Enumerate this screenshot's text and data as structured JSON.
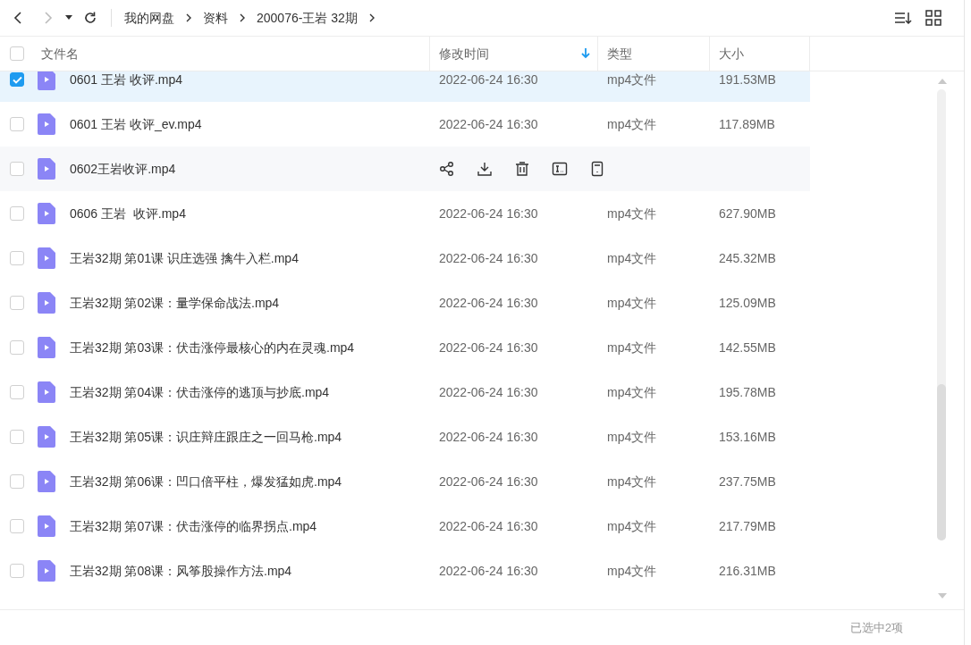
{
  "breadcrumb": [
    "我的网盘",
    "资料",
    "200076-王岩 32期"
  ],
  "columns": [
    {
      "label": "文件名",
      "sorted": false
    },
    {
      "label": "修改时间",
      "sorted": true
    },
    {
      "label": "类型",
      "sorted": false
    },
    {
      "label": "大小",
      "sorted": false
    }
  ],
  "header_checked": false,
  "rows": [
    {
      "name": "0601 王岩 收评.mp4",
      "modified": "2022-06-24 16:30",
      "type": "mp4文件",
      "size": "191.53MB",
      "checked": true,
      "hovered": false
    },
    {
      "name": "0601 王岩 收评_ev.mp4",
      "modified": "2022-06-24 16:30",
      "type": "mp4文件",
      "size": "117.89MB",
      "checked": false,
      "hovered": false
    },
    {
      "name": "0602王岩收评.mp4",
      "checked": false,
      "hovered": true
    },
    {
      "name": "0606 王岩  收评.mp4",
      "modified": "2022-06-24 16:30",
      "type": "mp4文件",
      "size": "627.90MB",
      "checked": false,
      "hovered": false
    },
    {
      "name": "王岩32期 第01课 识庄选强 擒牛入栏.mp4",
      "modified": "2022-06-24 16:30",
      "type": "mp4文件",
      "size": "245.32MB",
      "checked": false,
      "hovered": false
    },
    {
      "name": "王岩32期 第02课：量学保命战法.mp4",
      "modified": "2022-06-24 16:30",
      "type": "mp4文件",
      "size": "125.09MB",
      "checked": false,
      "hovered": false
    },
    {
      "name": "王岩32期 第03课：伏击涨停最核心的内在灵魂.mp4",
      "modified": "2022-06-24 16:30",
      "type": "mp4文件",
      "size": "142.55MB",
      "checked": false,
      "hovered": false
    },
    {
      "name": "王岩32期 第04课：伏击涨停的逃顶与抄底.mp4",
      "modified": "2022-06-24 16:30",
      "type": "mp4文件",
      "size": "195.78MB",
      "checked": false,
      "hovered": false
    },
    {
      "name": "王岩32期 第05课：识庄辩庄跟庄之一回马枪.mp4",
      "modified": "2022-06-24 16:30",
      "type": "mp4文件",
      "size": "153.16MB",
      "checked": false,
      "hovered": false
    },
    {
      "name": "王岩32期 第06课：凹口倍平柱，爆发猛如虎.mp4",
      "modified": "2022-06-24 16:30",
      "type": "mp4文件",
      "size": "237.75MB",
      "checked": false,
      "hovered": false
    },
    {
      "name": "王岩32期 第07课：伏击涨停的临界拐点.mp4",
      "modified": "2022-06-24 16:30",
      "type": "mp4文件",
      "size": "217.79MB",
      "checked": false,
      "hovered": false
    },
    {
      "name": "王岩32期 第08课：风筝股操作方法.mp4",
      "modified": "2022-06-24 16:30",
      "type": "mp4文件",
      "size": "216.31MB",
      "checked": false,
      "hovered": false
    }
  ],
  "status_bar": "已选中2项"
}
